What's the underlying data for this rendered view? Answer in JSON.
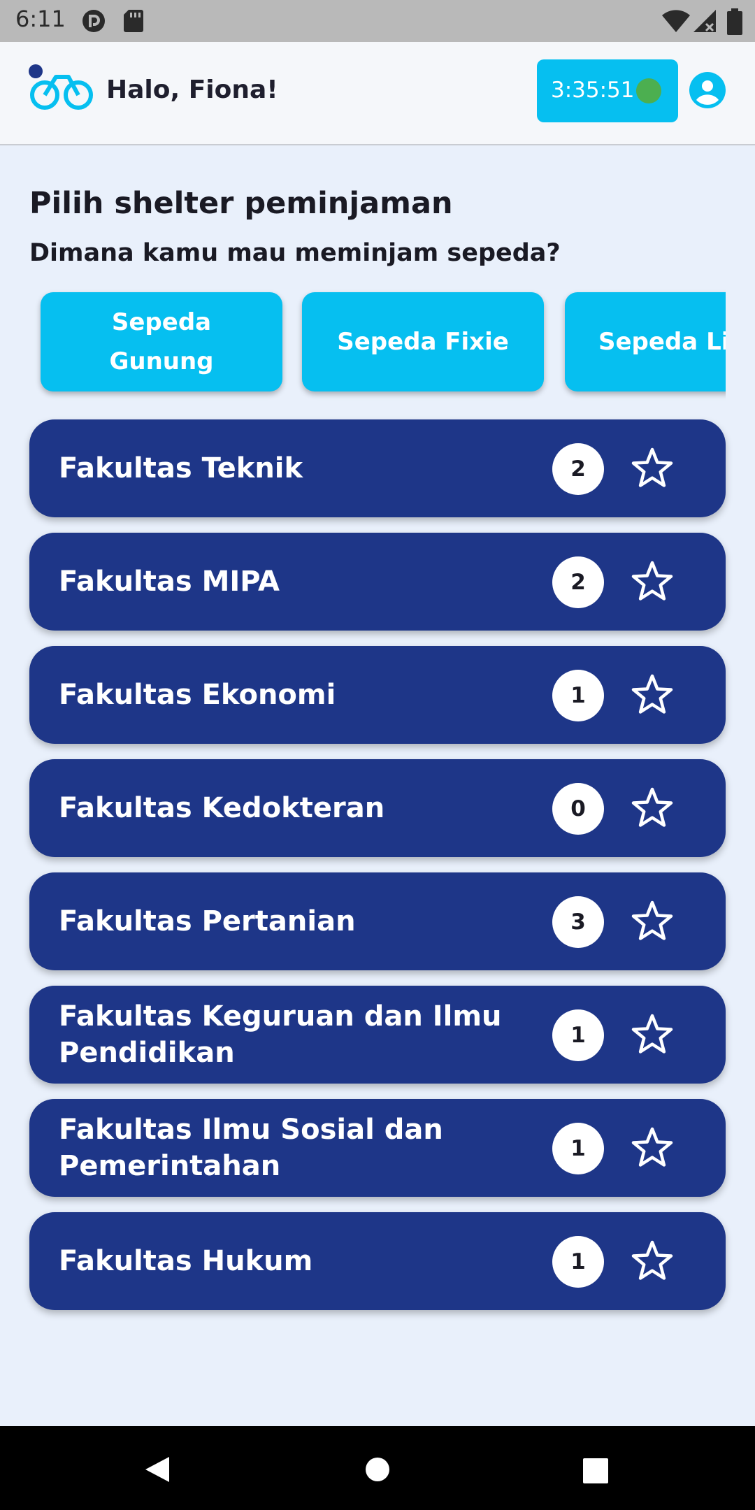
{
  "status_bar": {
    "time": "6:11",
    "icons": [
      "pocket-casts-icon",
      "sd-card-icon",
      "wifi-icon",
      "signal-icon",
      "battery-icon"
    ]
  },
  "header": {
    "logo_icon": "bicycle-logo-icon",
    "greeting": "Halo, Fiona!",
    "timer": "3:35:51",
    "timer_status_color": "#4caf50",
    "profile_icon": "account-circle-icon"
  },
  "main": {
    "title": "Pilih shelter peminjaman",
    "subtitle": "Dimana kamu mau meminjam sepeda?",
    "categories": [
      {
        "label": "Sepeda Gunung"
      },
      {
        "label": "Sepeda Fixie"
      },
      {
        "label": "Sepeda Listrik"
      }
    ],
    "shelters": [
      {
        "name": "Fakultas Teknik",
        "count": "2"
      },
      {
        "name": "Fakultas MIPA",
        "count": "2"
      },
      {
        "name": "Fakultas Ekonomi",
        "count": "1"
      },
      {
        "name": "Fakultas Kedokteran",
        "count": "0"
      },
      {
        "name": "Fakultas Pertanian",
        "count": "3"
      },
      {
        "name": "Fakultas Keguruan dan Ilmu Pendidikan",
        "count": "1"
      },
      {
        "name": "Fakultas Ilmu Sosial dan Pemerintahan",
        "count": "1"
      },
      {
        "name": "Fakultas Hukum",
        "count": "1"
      }
    ]
  },
  "nav_bar": {
    "icons": [
      "back-icon",
      "home-icon",
      "recents-icon"
    ]
  },
  "colors": {
    "accent": "#06bff0",
    "card": "#1e3688",
    "background": "#e9f0fb"
  }
}
